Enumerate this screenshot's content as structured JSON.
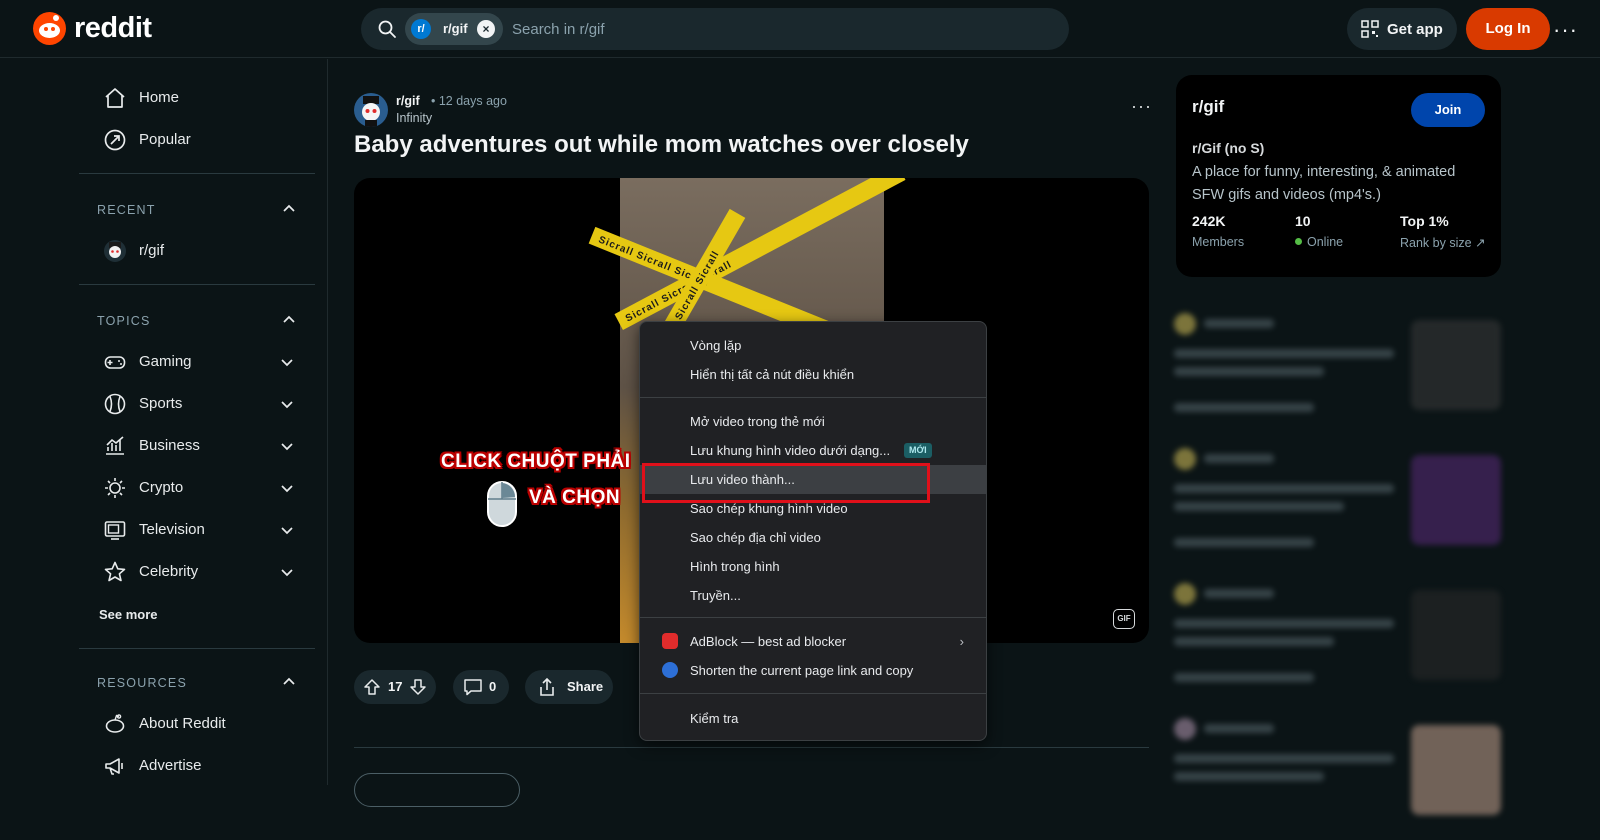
{
  "header": {
    "logo_text": "reddit",
    "search_chip": "r/gif",
    "search_chip_icon": "r/",
    "search_placeholder": "Search in r/gif",
    "get_app": "Get app",
    "login": "Log In",
    "more": "···",
    "accent": "#d93a00"
  },
  "sidebar": {
    "nav": [
      {
        "label": "Home",
        "icon": "home-icon"
      },
      {
        "label": "Popular",
        "icon": "popular-icon"
      }
    ],
    "recent_heading": "RECENT",
    "recent": [
      {
        "label": "r/gif",
        "icon": "subreddit-avatar"
      }
    ],
    "topics_heading": "TOPICS",
    "topics": [
      {
        "label": "Gaming",
        "icon": "gamepad-icon"
      },
      {
        "label": "Sports",
        "icon": "ball-icon"
      },
      {
        "label": "Business",
        "icon": "chart-icon"
      },
      {
        "label": "Crypto",
        "icon": "crypto-icon"
      },
      {
        "label": "Television",
        "icon": "tv-icon"
      },
      {
        "label": "Celebrity",
        "icon": "star-icon"
      }
    ],
    "see_more": "See more",
    "resources_heading": "RESOURCES",
    "resources": [
      {
        "label": "About Reddit",
        "icon": "reddit-icon"
      },
      {
        "label": "Advertise",
        "icon": "megaphone-icon"
      }
    ]
  },
  "post": {
    "subreddit": "r/gif",
    "time": "• 12 days ago",
    "user": "Infinity",
    "title": "Baby adventures out while mom watches over closely",
    "more": "···",
    "gif_badge": "GIF",
    "overlay_line1": "CLICK CHUỘT PHẢI",
    "overlay_line2": "VÀ CHỌN",
    "tape_text": "Sicrall Sicrall Sicrall",
    "votes": "17",
    "comments": "0",
    "share": "Share"
  },
  "context_menu": {
    "group1": [
      "Vòng lặp",
      "Hiển thị tất cả nút điều khiển"
    ],
    "group2": [
      "Mở video trong thẻ mới",
      "Lưu khung hình video dưới dạng...",
      "Lưu video thành...",
      "Sao chép khung hình video",
      "Sao chép địa chỉ video",
      "Hình trong hình",
      "Truyền..."
    ],
    "new_badge": "MỚI",
    "group3": [
      "AdBlock — best ad blocker",
      "Shorten the current page link and copy"
    ],
    "group4": [
      "Kiểm tra"
    ],
    "highlighted": "Lưu video thành...",
    "highlight_color": "#e0101a"
  },
  "community": {
    "title": "r/gif",
    "join": "Join",
    "name": "r/Gif (no S)",
    "description": "A place for funny, interesting, & animated SFW gifs and videos (mp4's.)",
    "members_value": "242K",
    "members_label": "Members",
    "online_value": "10",
    "online_label": "Online",
    "rank_value": "Top 1%",
    "rank_label": "Rank by size ↗"
  }
}
